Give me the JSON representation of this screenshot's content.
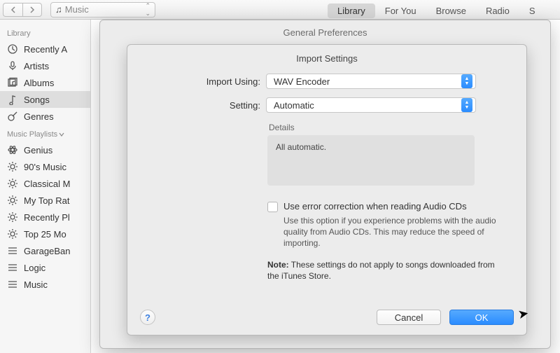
{
  "toolbar": {
    "source": "Music",
    "tabs": [
      "Library",
      "For You",
      "Browse",
      "Radio",
      "S"
    ],
    "active_tab": 0
  },
  "sidebar": {
    "section_library": "Library",
    "library_items": [
      {
        "icon": "clock-icon",
        "label": "Recently A"
      },
      {
        "icon": "mic-icon",
        "label": "Artists"
      },
      {
        "icon": "album-icon",
        "label": "Albums"
      },
      {
        "icon": "note-icon",
        "label": "Songs",
        "selected": true
      },
      {
        "icon": "guitar-icon",
        "label": "Genres"
      }
    ],
    "section_playlists": "Music Playlists",
    "playlist_items": [
      {
        "icon": "atom-icon",
        "label": "Genius"
      },
      {
        "icon": "gear-icon",
        "label": "90's Music"
      },
      {
        "icon": "gear-icon",
        "label": "Classical M"
      },
      {
        "icon": "gear-icon",
        "label": "My Top Rat"
      },
      {
        "icon": "gear-icon",
        "label": "Recently Pl"
      },
      {
        "icon": "gear-icon",
        "label": "Top 25 Mo"
      },
      {
        "icon": "list-icon",
        "label": "GarageBan"
      },
      {
        "icon": "list-icon",
        "label": "Logic"
      },
      {
        "icon": "list-icon",
        "label": "Music"
      }
    ]
  },
  "sheet": {
    "title": "General Preferences"
  },
  "dialog": {
    "title": "Import Settings",
    "import_using_label": "Import Using:",
    "import_using_value": "WAV Encoder",
    "setting_label": "Setting:",
    "setting_value": "Automatic",
    "details_header": "Details",
    "details_text": "All automatic.",
    "checkbox_label": "Use error correction when reading Audio CDs",
    "checkbox_desc": "Use this option if you experience problems with the audio quality from Audio CDs.  This may reduce the speed of importing.",
    "note_prefix": "Note:",
    "note_rest": " These settings do not apply to songs downloaded from the iTunes Store.",
    "help": "?",
    "cancel": "Cancel",
    "ok": "OK"
  }
}
